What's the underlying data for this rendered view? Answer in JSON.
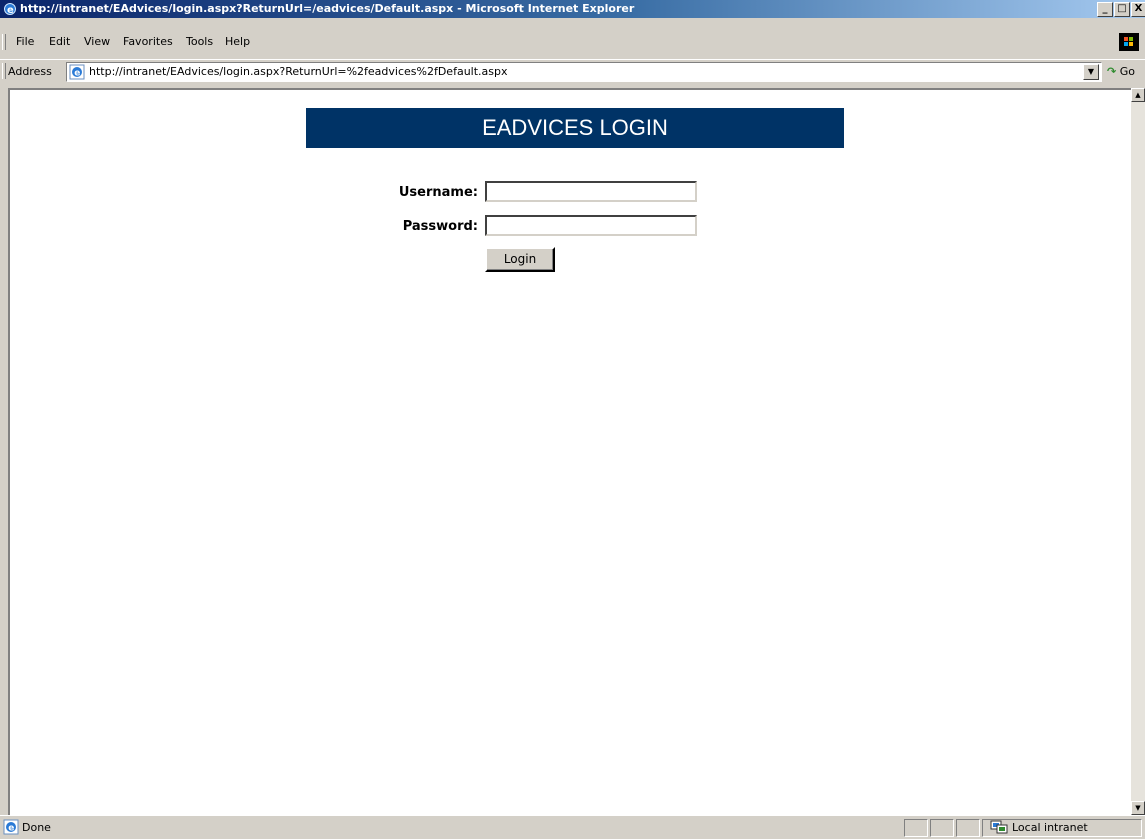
{
  "window": {
    "title": "http://intranet/EAdvices/login.aspx?ReturnUrl=/eadvices/Default.aspx - Microsoft Internet Explorer",
    "controls": [
      "_",
      "□",
      "X"
    ]
  },
  "menu": {
    "items": [
      {
        "label": "File"
      },
      {
        "label": "Edit"
      },
      {
        "label": "View"
      },
      {
        "label": "Favorites"
      },
      {
        "label": "Tools"
      },
      {
        "label": "Help"
      }
    ]
  },
  "address": {
    "label": "Address",
    "url": "http://intranet/EAdvices/login.aspx?ReturnUrl=%2feadvices%2fDefault.aspx",
    "go_label": "Go"
  },
  "page": {
    "header": "EADVICES LOGIN",
    "username_label": "Username:",
    "password_label": "Password:",
    "username_value": "",
    "password_value": "",
    "login_button": "Login",
    "header_color": "#003366"
  },
  "status": {
    "text": "Done",
    "zone": "Local intranet"
  },
  "icons": {
    "title_icon": "ie-icon",
    "address_icon": "ie-page-icon",
    "status_icon": "ie-page-icon",
    "zone_icon": "local-intranet-icon",
    "windows_logo": "windows-logo-icon"
  }
}
